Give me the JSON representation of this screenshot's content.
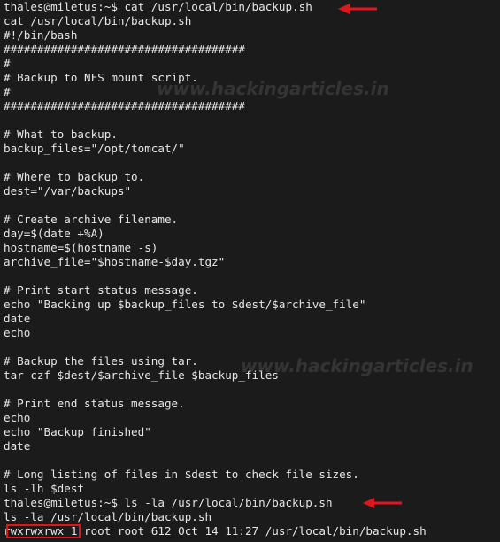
{
  "watermark": "www.hackingarticles.in",
  "colors": {
    "background": "#1b1b1b",
    "text": "#e6e6e6",
    "annotation": "#e0161e"
  },
  "annotations": {
    "arrow1": "red-arrow-left-icon",
    "arrow2": "red-arrow-left-icon",
    "box": "red-highlight-box"
  },
  "lines": [
    "thales@miletus:~$ cat /usr/local/bin/backup.sh",
    "cat /usr/local/bin/backup.sh",
    "#!/bin/bash",
    "####################################",
    "#",
    "# Backup to NFS mount script.",
    "#",
    "####################################",
    "",
    "# What to backup.",
    "backup_files=\"/opt/tomcat/\"",
    "",
    "# Where to backup to.",
    "dest=\"/var/backups\"",
    "",
    "# Create archive filename.",
    "day=$(date +%A)",
    "hostname=$(hostname -s)",
    "archive_file=\"$hostname-$day.tgz\"",
    "",
    "# Print start status message.",
    "echo \"Backing up $backup_files to $dest/$archive_file\"",
    "date",
    "echo",
    "",
    "# Backup the files using tar.",
    "tar czf $dest/$archive_file $backup_files",
    "",
    "# Print end status message.",
    "echo",
    "echo \"Backup finished\"",
    "date",
    "",
    "# Long listing of files in $dest to check file sizes.",
    "ls -lh $dest",
    "thales@miletus:~$ ls -la /usr/local/bin/backup.sh",
    "ls -la /usr/local/bin/backup.sh",
    "rwxrwxrwx 1 root root 612 Oct 14 11:27 /usr/local/bin/backup.sh"
  ]
}
